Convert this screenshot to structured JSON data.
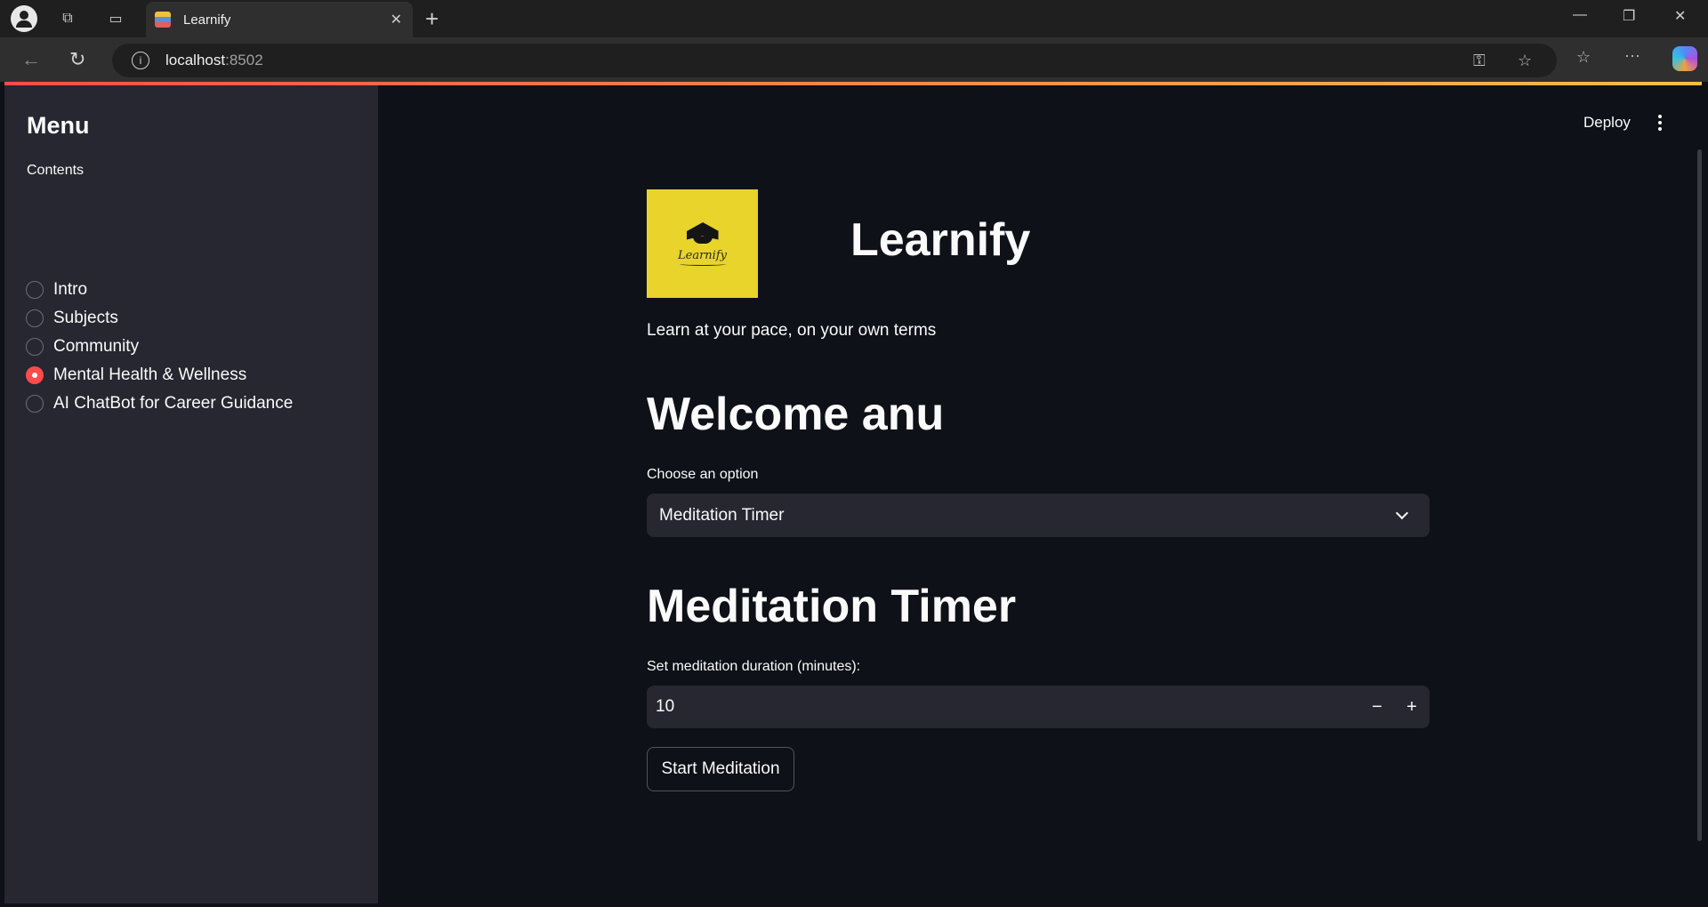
{
  "browser": {
    "tab_title": "Learnify",
    "url_host": "localhost",
    "url_port": ":8502"
  },
  "sidebar": {
    "title": "Menu",
    "group_label": "Contents",
    "items": [
      {
        "label": "Intro",
        "selected": false
      },
      {
        "label": "Subjects",
        "selected": false
      },
      {
        "label": "Community",
        "selected": false
      },
      {
        "label": "Mental Health & Wellness",
        "selected": true
      },
      {
        "label": "AI ChatBot for Career Guidance",
        "selected": false
      }
    ]
  },
  "toolbar": {
    "deploy_label": "Deploy"
  },
  "header": {
    "logo_text": "Learnify",
    "title": "Learnify",
    "tagline": "Learn at your pace, on your own terms"
  },
  "main": {
    "welcome": "Welcome anu",
    "choose_label": "Choose an option",
    "choose_value": "Meditation Timer",
    "section_title": "Meditation Timer",
    "duration_label": "Set meditation duration (minutes):",
    "duration_value": "10",
    "start_button": "Start Meditation"
  },
  "colors": {
    "accent": "#ff4b4b",
    "logo_bg": "#e8d42a",
    "sidebar_bg": "#262730",
    "main_bg": "#0e1117"
  }
}
